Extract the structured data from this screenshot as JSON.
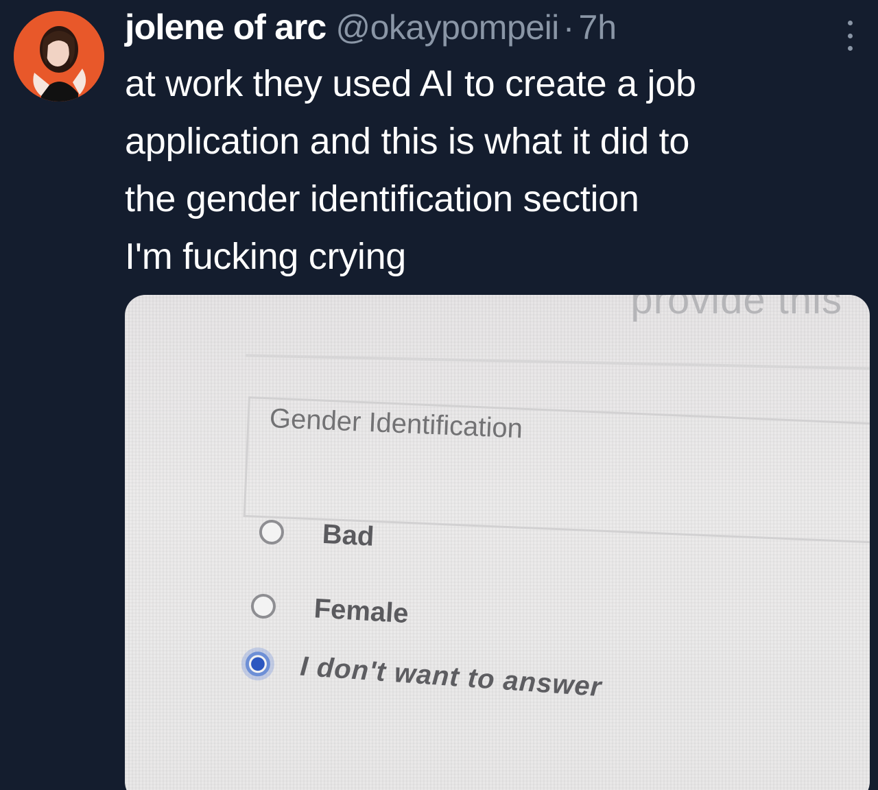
{
  "author": {
    "display_name": "jolene of arc",
    "handle": "@okaypompeii",
    "separator": "·",
    "time": "7h",
    "avatar_icon": "profile-photo"
  },
  "tweet": {
    "lines": [
      "at work they used AI to create a job",
      "application and this is what it did to",
      "the gender identification section",
      "I'm fucking crying"
    ]
  },
  "media": {
    "cut_off_text": "provide this",
    "field_label": "Gender Identification",
    "options": [
      {
        "label": "Bad",
        "selected": false
      },
      {
        "label": "Female",
        "selected": false
      },
      {
        "label": "I don't want to answer",
        "selected": true
      }
    ]
  },
  "colors": {
    "background": "#141d2e",
    "text_primary": "#ffffff",
    "text_secondary": "#8a96a6",
    "avatar_bg": "#e8582a",
    "radio_checked": "#2c57c0"
  }
}
